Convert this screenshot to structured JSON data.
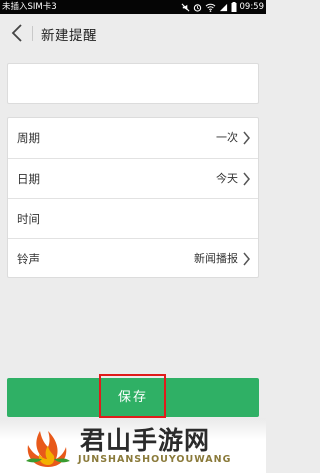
{
  "status_bar": {
    "carrier": "未插入SIM卡3",
    "time": "09:59",
    "icons": [
      "mute-icon",
      "alarm-icon",
      "wifi-icon",
      "signal-icon",
      "battery-icon"
    ]
  },
  "nav": {
    "back_icon": "chevron-left-icon",
    "title": "新建提醒"
  },
  "reminder_input": {
    "value": "",
    "placeholder": ""
  },
  "settings": {
    "rows": [
      {
        "label": "周期",
        "value": "一次",
        "chevron": true
      },
      {
        "label": "日期",
        "value": "今天",
        "chevron": true
      },
      {
        "label": "时间",
        "value": "",
        "chevron": false
      },
      {
        "label": "铃声",
        "value": "新闻播报",
        "chevron": true
      }
    ]
  },
  "save_button": {
    "label": "保存"
  },
  "colors": {
    "accent_green": "#2fb065",
    "highlight_red": "#e11b1b",
    "background": "#ececec"
  },
  "watermark": {
    "title": "君山手游网",
    "subtitle": "JUNSHANSHOUYOUWANG"
  }
}
